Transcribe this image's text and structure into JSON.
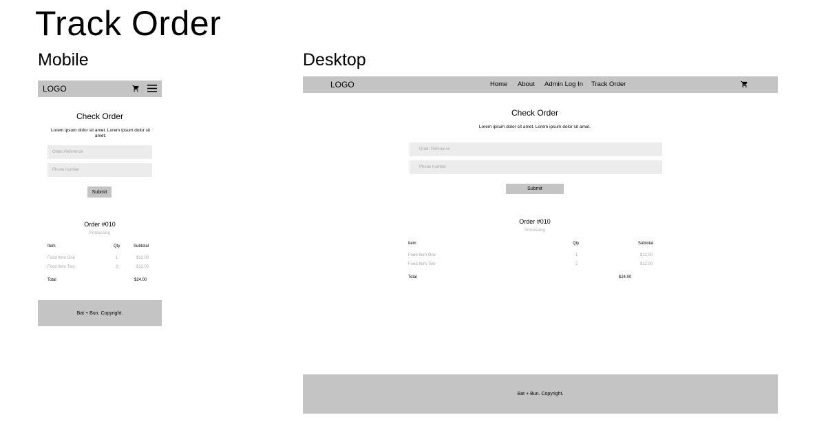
{
  "page": {
    "title": "Track Order"
  },
  "mobile": {
    "label": "Mobile",
    "header": {
      "logo": "LOGO",
      "cart_icon": "cart-icon",
      "menu_icon": "hamburger-menu-icon"
    },
    "check": {
      "title": "Check Order",
      "description": "Lorem ipsum dolor sit amet. Lorem ipsum dolor sit amet.",
      "order_reference_placeholder": "Order Reference",
      "phone_placeholder": "Phone number",
      "submit_label": "Submit"
    },
    "order": {
      "title": "Order #010",
      "status": "Processing",
      "columns": {
        "item": "Item",
        "qty": "Qty",
        "subtotal": "Subtotal"
      },
      "rows": [
        {
          "item": "Food Item One",
          "qty": "1",
          "subtotal": "$12.00"
        },
        {
          "item": "Food Item Two",
          "qty": "2",
          "subtotal": "$12.00"
        }
      ],
      "total_label": "Total",
      "total_value": "$24.00"
    },
    "footer": {
      "text": "Bat + Bun. Copyright."
    }
  },
  "desktop": {
    "label": "Desktop",
    "header": {
      "logo": "LOGO",
      "nav": [
        "Home",
        "About",
        "Admin Log In",
        "Track Order"
      ],
      "cart_icon": "cart-icon"
    },
    "check": {
      "title": "Check Order",
      "description": "Lorem ipsum dolor sit amet. Lorem ipsum dolor sit amet.",
      "order_reference_placeholder": "Order Reference",
      "phone_placeholder": "Phone number",
      "submit_label": "Submit"
    },
    "order": {
      "title": "Order #010",
      "status": "Processing",
      "columns": {
        "item": "Item",
        "qty": "Qty",
        "subtotal": "Subtotal"
      },
      "rows": [
        {
          "item": "Food Item One",
          "qty": "1",
          "subtotal": "$12.00"
        },
        {
          "item": "Food Item Two",
          "qty": "2",
          "subtotal": "$12.00"
        }
      ],
      "total_label": "Total",
      "total_value": "$24.00"
    },
    "footer": {
      "text": "Bat + Bun. Copyright."
    }
  },
  "colors": {
    "bar": "#c4c4c4",
    "field": "#ececec",
    "muted_text": "#a9a9a9"
  }
}
